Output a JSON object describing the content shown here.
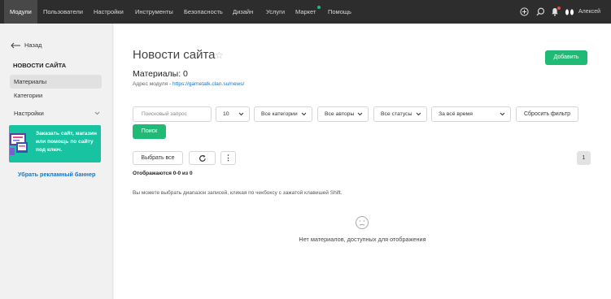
{
  "topnav": {
    "items": [
      "Модули",
      "Пользователи",
      "Настройки",
      "Инструменты",
      "Безопасность",
      "Дизайн",
      "Услуги",
      "Маркет",
      "Помощь"
    ],
    "user_name": "Алексей",
    "notification_dot_color": "#e74c3c",
    "market_dot_color": "#1fba76"
  },
  "sidebar": {
    "back_label": "Назад",
    "heading": "НОВОСТИ САЙТА",
    "items": [
      "Материалы",
      "Категории",
      "Настройки"
    ],
    "promo_text": "Заказать сайт, магазин или помощь по сайту под ключ.",
    "promo_link": "Убрать рекламный баннер"
  },
  "main": {
    "title": "Новости сайта",
    "add_button": "Добавить",
    "count_label": "Материалы: 0",
    "module_address_label": "Адрес модуля - ",
    "module_address_url": "https://gametalk.clan.su/news/"
  },
  "filters": {
    "search_placeholder": "Поисковый запрос",
    "per_page": "10",
    "category": "Все категории",
    "author": "Все авторы",
    "status": "Все статусы",
    "period": "За всё время",
    "reset": "Сбросить фильтр",
    "search_button": "Поиск"
  },
  "list": {
    "select_all": "Выбрать все",
    "page": "1",
    "shown_text": "Отображаются 0-0 из 0",
    "hint": "Вы можете выбрать диапазон записей, кликая по чекбоксу с зажатой клавишей Shift.",
    "empty_text": "Нет материалов, доступных для отображения"
  }
}
